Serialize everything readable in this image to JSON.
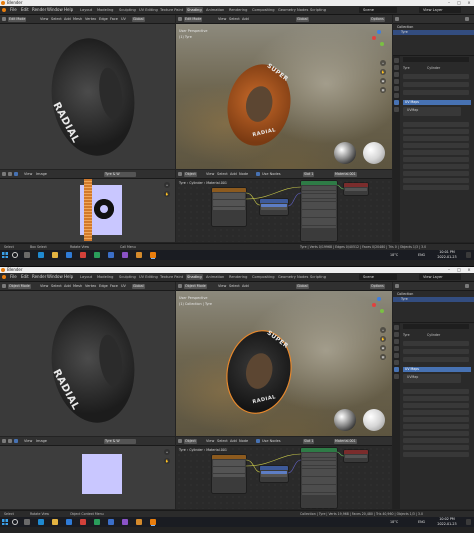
{
  "window": {
    "title": "Blender"
  },
  "menu": [
    "File",
    "Edit",
    "Render",
    "Window",
    "Help"
  ],
  "workspaces": [
    "Layout",
    "Modeling",
    "Sculpting",
    "UV Editing",
    "Texture Paint",
    "Shading",
    "Animation",
    "Rendering",
    "Compositing",
    "Geometry Nodes",
    "Scripting"
  ],
  "active_workspace": "Shading",
  "scene_label": "Scene",
  "view_layer_label": "View Layer",
  "viewport_menu": [
    "View",
    "Select",
    "Add",
    "Mesh",
    "Vertex",
    "Edge",
    "Face",
    "UV"
  ],
  "object_menu": [
    "View",
    "Select",
    "Add",
    "Object"
  ],
  "transform_orientation": "Global",
  "options_label": "Options",
  "tire_text_a": "RADIAL",
  "tire_text_b": "SUPER",
  "tire_text_c": "RADIAL",
  "uv_menu": [
    "View",
    "Image"
  ],
  "node_header": {
    "object_label": "Object",
    "menu": [
      "View",
      "Select",
      "Add",
      "Node"
    ],
    "use_nodes": "Use Nodes",
    "slot": "Slot 1",
    "material": "Material.001"
  },
  "breadcrumb": {
    "object": "Tyre",
    "mesh": "Cylinder",
    "material": "Material.001"
  },
  "outliner": {
    "collection": "Collection",
    "object": "Tyre"
  },
  "properties": {
    "object": "Tyre",
    "mesh": "Cylinder",
    "uv_maps_label": "UV Maps",
    "uv_map_name": "UVMap"
  },
  "taskbar": {
    "weather": "18°C",
    "lang": "ENG"
  },
  "shots": [
    {
      "mode": "Edit Mode",
      "vp_title": "User Perspective",
      "vp_sub": "(1) Tyre",
      "image_name": "Tyre & W",
      "status": [
        "Select",
        "Box Select",
        "Rotate View",
        "Call Menu"
      ],
      "stats": "Tyre | Verts 0/19968 | Edges 0/40512 | Faces 0/20480 | Tris 0 | Objects 1/3 | 3.0",
      "time": "10:01 PM",
      "date": "2022-01-23"
    },
    {
      "mode": "Object Mode",
      "vp_title": "User Perspective",
      "vp_sub": "(1) Collection | Tyre",
      "image_name": "Tyre & W",
      "status": [
        "Select",
        "Rotate View",
        "Object Context Menu"
      ],
      "stats": "Collection | Tyre | Verts 19,968 | Faces 20,480 | Tris 40,960 | Objects 1/3 | 3.0",
      "time": "10:02 PM",
      "date": "2022-01-23"
    }
  ]
}
